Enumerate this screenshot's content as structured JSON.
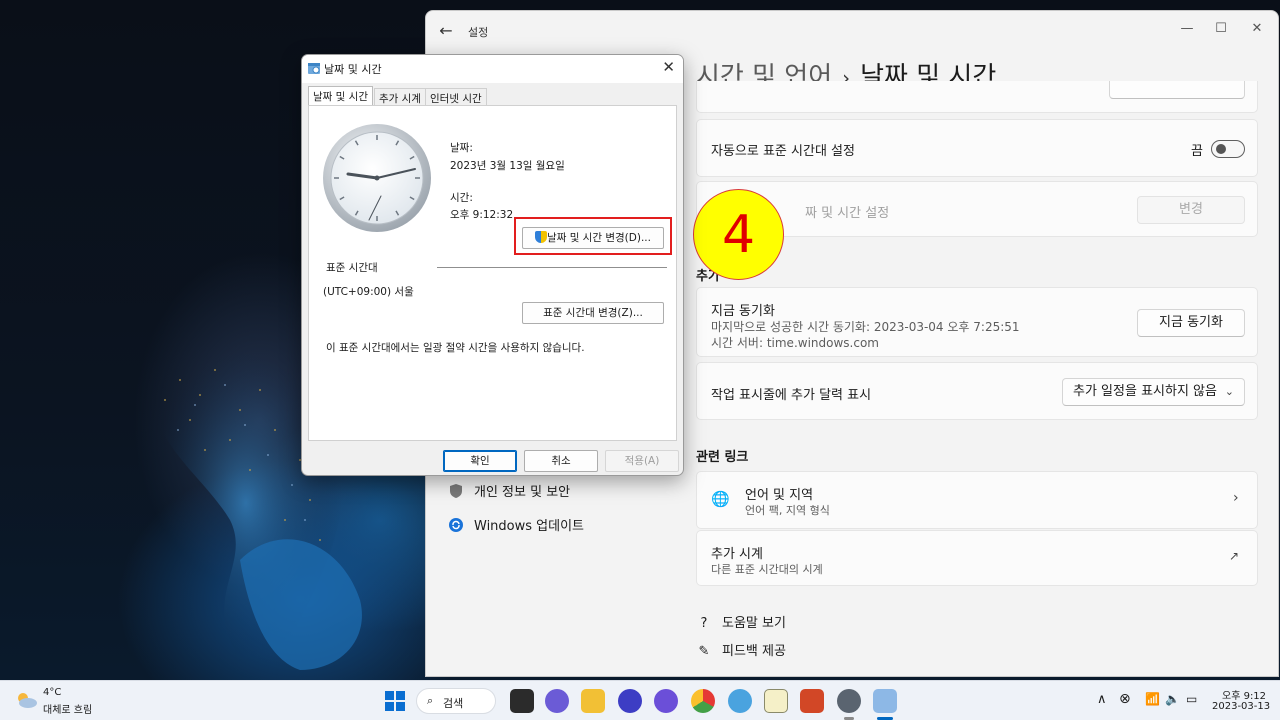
{
  "settings": {
    "app_title": "설정",
    "breadcrumb_parent": "시간 및 언어",
    "breadcrumb_sep": "›",
    "breadcrumb_current": "날짜 및 시간",
    "auto_timezone": {
      "label": "자동으로 표준 시간대 설정",
      "state": "끔"
    },
    "manual_time": {
      "label": "날짜 및 시간 설정",
      "partial_label": "짜 및 시간 설정",
      "button": "변경"
    },
    "extra_section_partial": "추가",
    "sync": {
      "title": "지금 동기화",
      "last_sync": "마지막으로 성공한 시간 동기화: 2023-03-04 오후 7:25:51",
      "server": "시간 서버: time.windows.com",
      "button": "지금 동기화"
    },
    "taskbar_calendar": {
      "label": "작업 표시줄에 추가 달력 표시",
      "value": "추가 일정을 표시하지 않음"
    },
    "related_links_title": "관련 링크",
    "language_region": {
      "title": "언어 및 지역",
      "subtitle": "언어 팩, 지역 형식"
    },
    "extra_clocks": {
      "title": "추가 시계",
      "subtitle": "다른 표준 시간대의 시계"
    },
    "help": "도움말 보기",
    "feedback": "피드백 제공",
    "nav": {
      "privacy": "개인 정보 및 보안",
      "update": "Windows 업데이트"
    }
  },
  "dialog": {
    "title": "날짜 및 시간",
    "tabs": [
      "날짜 및 시간",
      "추가 시계",
      "인터넷 시간"
    ],
    "date_label": "날짜:",
    "date_value": "2023년 3월 13일 월요일",
    "time_label": "시간:",
    "time_value": "오후 9:12:32",
    "change_datetime_button": "날짜 및 시간 변경(D)...",
    "timezone_label": "표준 시간대",
    "timezone_value": "(UTC+09:00) 서울",
    "change_timezone_button": "표준 시간대 변경(Z)...",
    "dst_note": "이 표준 시간대에서는 일광 절약 시간을 사용하지 않습니다.",
    "ok": "확인",
    "cancel": "취소",
    "apply": "적용(A)"
  },
  "step_marker": "4",
  "taskbar": {
    "weather_temp": "4°C",
    "weather_desc": "대체로 흐림",
    "search": "검색",
    "clock_time": "오후 9:12",
    "clock_date": "2023-03-13"
  },
  "colors": {
    "highlight_red": "#e21e1e",
    "step_yellow": "#ffff00",
    "step_text": "#e00000",
    "accent": "#0067c0"
  }
}
